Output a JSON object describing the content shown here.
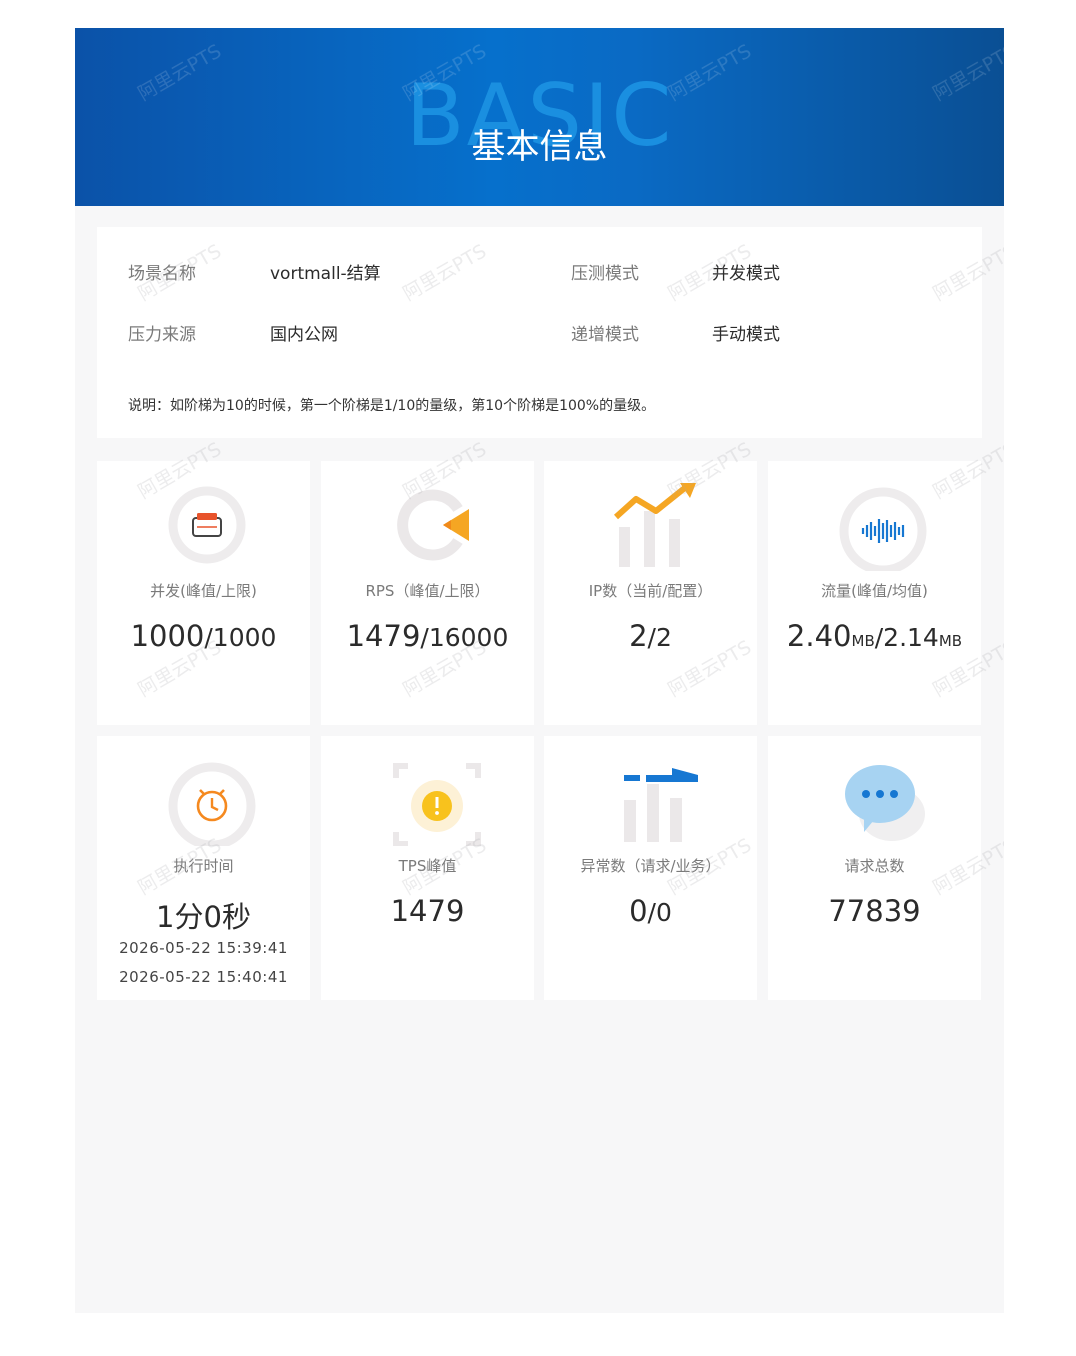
{
  "header": {
    "bg_word": "BASIC",
    "title": "基本信息"
  },
  "info": {
    "scene_label": "场景名称",
    "scene_value": "vortmall-结算",
    "mode_label": "压测模式",
    "mode_value": "并发模式",
    "source_label": "压力来源",
    "source_value": "国内公网",
    "ramp_label": "递增模式",
    "ramp_value": "手动模式",
    "note": "说明：如阶梯为10的时候，第一个阶梯是1/10的量级，第10个阶梯是100%的量级。"
  },
  "metrics": {
    "concurrency": {
      "label": "并发(峰值/上限)",
      "peak": "1000",
      "limit": "/1000",
      "icon": "wallet-icon"
    },
    "rps": {
      "label": "RPS（峰值/上限）",
      "peak": "1479",
      "limit": "/16000",
      "icon": "speaker-play-icon"
    },
    "ip": {
      "label": "IP数（当前/配置）",
      "current": "2",
      "config": "/2",
      "icon": "trend-bar-icon"
    },
    "traffic": {
      "label": "流量(峰值/均值)",
      "peak": "2.40",
      "peak_unit": "MB",
      "avg": "/2.14",
      "avg_unit": "MB",
      "icon": "sound-wave-icon"
    },
    "duration": {
      "label": "执行时间",
      "value": "1分0秒",
      "start": "2026-05-22 15:39:41",
      "end": "2026-05-22 15:40:41",
      "icon": "alarm-clock-icon"
    },
    "tps": {
      "label": "TPS峰值",
      "value": "1479",
      "icon": "warning-scan-icon"
    },
    "errors": {
      "label": "异常数（请求/业务）",
      "req": "0",
      "biz": "/0",
      "icon": "error-bars-icon"
    },
    "requests": {
      "label": "请求总数",
      "value": "77839",
      "icon": "chat-bubble-icon"
    }
  },
  "watermark": "阿里云PTS",
  "colors": {
    "header_blue": "#0670cc",
    "accent_orange": "#f5a623",
    "accent_blue": "#1677d2"
  }
}
